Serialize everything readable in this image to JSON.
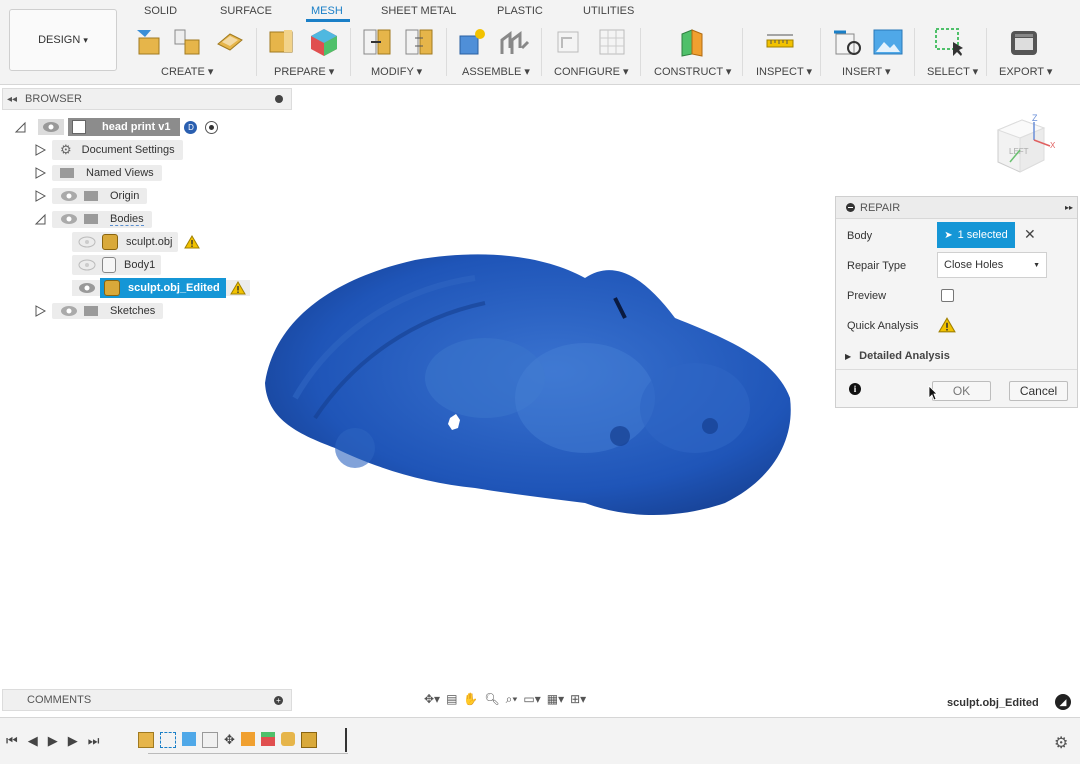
{
  "workspace": {
    "label": "DESIGN",
    "caret": "▾"
  },
  "tabs": [
    "SOLID",
    "SURFACE",
    "MESH",
    "SHEET METAL",
    "PLASTIC",
    "UTILITIES"
  ],
  "groups": [
    "CREATE ▾",
    "PREPARE ▾",
    "MODIFY ▾",
    "ASSEMBLE ▾",
    "CONFIGURE ▾",
    "CONSTRUCT ▾",
    "INSPECT ▾",
    "INSERT ▾",
    "SELECT ▾",
    "EXPORT ▾"
  ],
  "browser": {
    "title": "BROWSER",
    "root": "head print v1",
    "items": {
      "doc_settings": "Document Settings",
      "named_views": "Named Views",
      "origin": "Origin",
      "bodies": "Bodies",
      "sculpt": "sculpt.obj",
      "body1": "Body1",
      "sculpt_edited": "sculpt.obj_Edited",
      "sketches": "Sketches"
    }
  },
  "viewcube": {
    "face": "LEFT",
    "axis_z": "Z",
    "axis_x": "X"
  },
  "repair": {
    "title": "REPAIR",
    "body_label": "Body",
    "body_value": "1 selected",
    "type_label": "Repair Type",
    "type_value": "Close Holes",
    "preview_label": "Preview",
    "preview_checked": false,
    "quick_label": "Quick Analysis",
    "detailed_label": "Detailed Analysis",
    "ok": "OK",
    "cancel": "Cancel"
  },
  "comments": {
    "title": "COMMENTS"
  },
  "status": {
    "selection": "sculpt.obj_Edited"
  },
  "colors": {
    "accent": "#1a7fc7",
    "selected": "#1596d6",
    "mesh": "#1f55b8",
    "warning": "#f2c200"
  }
}
